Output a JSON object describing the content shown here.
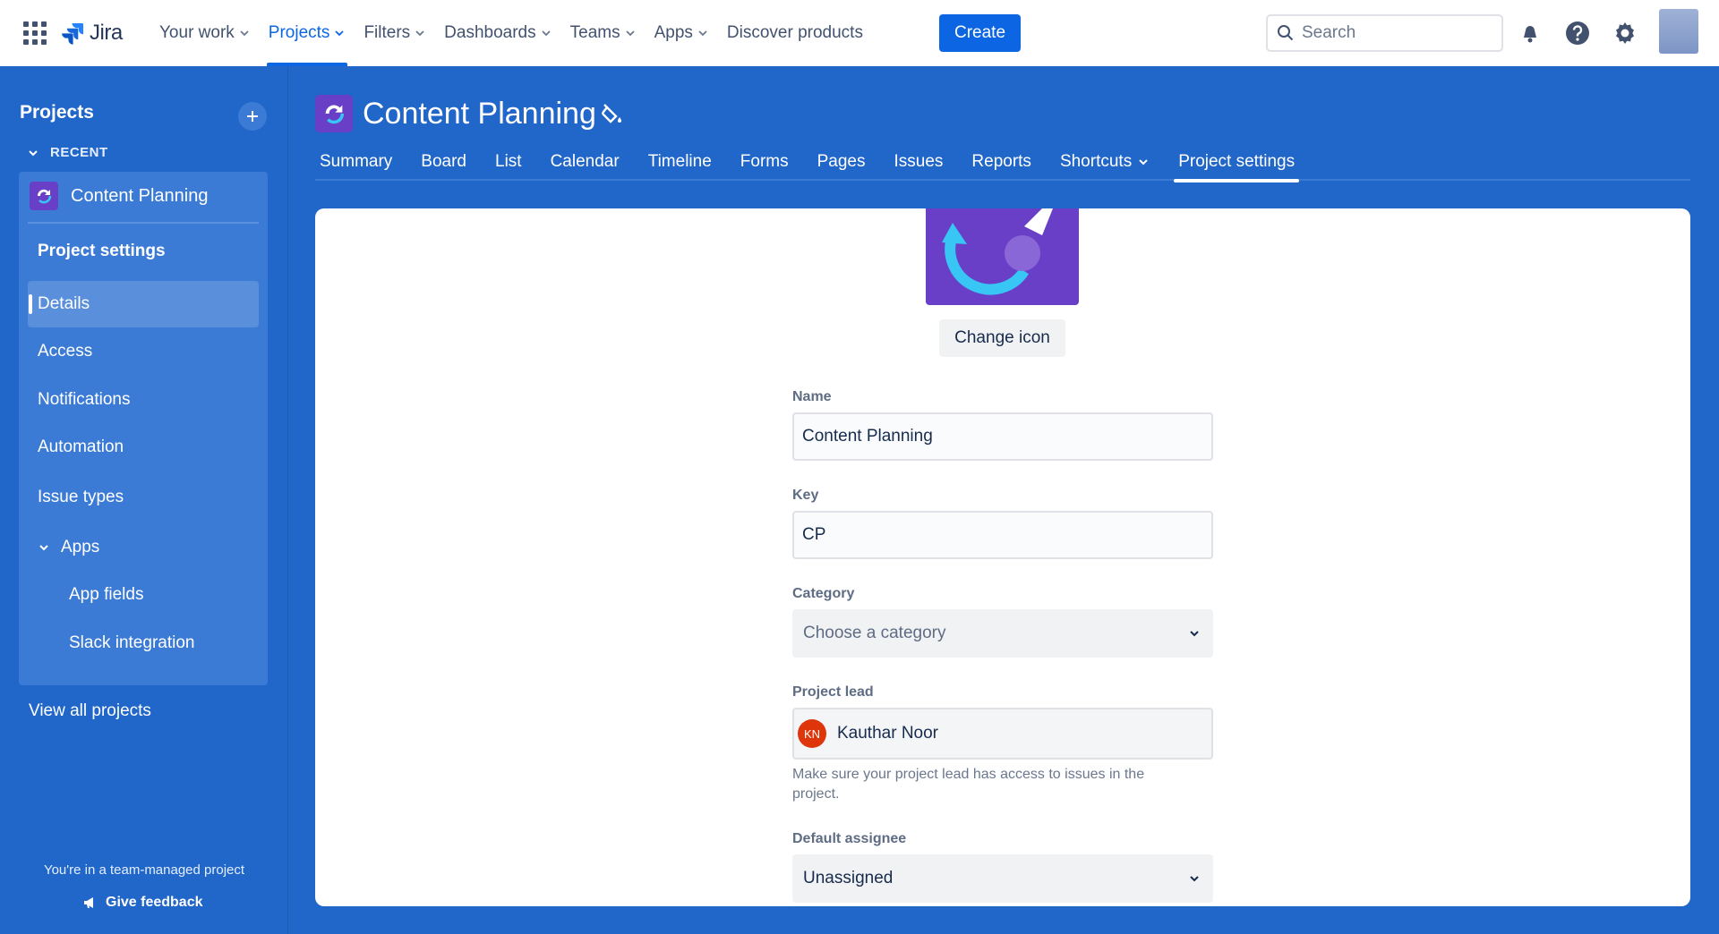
{
  "topnav": {
    "logo_text": "Jira",
    "items": [
      {
        "label": "Your work",
        "active": false
      },
      {
        "label": "Projects",
        "active": true
      },
      {
        "label": "Filters",
        "active": false
      },
      {
        "label": "Dashboards",
        "active": false
      },
      {
        "label": "Teams",
        "active": false
      },
      {
        "label": "Apps",
        "active": false
      }
    ],
    "discover": "Discover products",
    "create": "Create",
    "search_placeholder": "Search"
  },
  "sidebar": {
    "title": "Projects",
    "recent": "RECENT",
    "project_name": "Content Planning",
    "section": "Project settings",
    "items": [
      {
        "label": "Details",
        "selected": true
      },
      {
        "label": "Access"
      },
      {
        "label": "Notifications"
      },
      {
        "label": "Automation"
      },
      {
        "label": "Issue types"
      },
      {
        "label": "Apps"
      },
      {
        "label": "App fields"
      },
      {
        "label": "Slack integration"
      }
    ],
    "view_all": "View all projects",
    "team_note": "You're in a team-managed project",
    "feedback": "Give feedback"
  },
  "header": {
    "title": "Content Planning",
    "tabs": [
      "Summary",
      "Board",
      "List",
      "Calendar",
      "Timeline",
      "Forms",
      "Pages",
      "Issues",
      "Reports",
      "Shortcuts",
      "Project settings"
    ],
    "active_tab": "Project settings"
  },
  "form": {
    "change_icon": "Change icon",
    "name_label": "Name",
    "name_value": "Content Planning",
    "key_label": "Key",
    "key_value": "CP",
    "category_label": "Category",
    "category_placeholder": "Choose a category",
    "lead_label": "Project lead",
    "lead_initials": "KN",
    "lead_name": "Kauthar Noor",
    "lead_helper": "Make sure your project lead has access to issues in the project.",
    "assignee_label": "Default assignee",
    "assignee_value": "Unassigned"
  },
  "colors": {
    "brand_blue": "#0c66e4",
    "sidebar_bg": "#2166c9",
    "project_icon": "#6a3fc7"
  }
}
